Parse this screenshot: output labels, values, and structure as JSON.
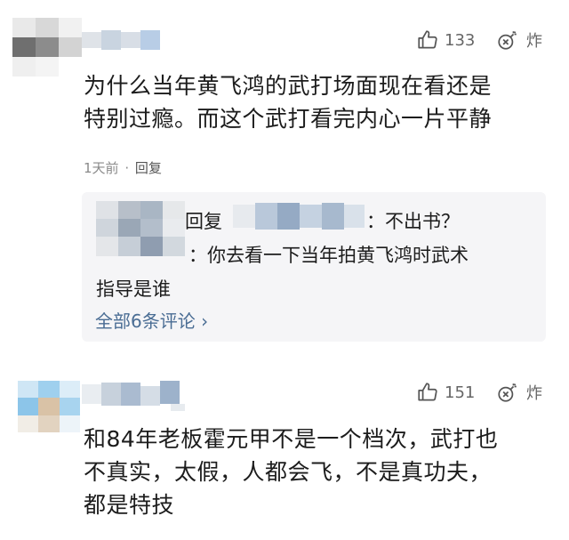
{
  "comments": [
    {
      "likes": "133",
      "bomb_label": "炸",
      "text_lines": [
        "为什么当年黄飞鸿的武打场面现在看还是",
        "特别过瘾。而这个武打看完内心一片平静"
      ],
      "time": "1天前",
      "separator": "·",
      "reply_label": "回复",
      "replies": {
        "reply1_prefix": "回复",
        "reply1_text": "：不出书？",
        "reply2_line1": "：你去看一下当年拍黄飞鸿时武术",
        "reply2_line2": "指导是谁",
        "all_replies": "全部6条评论 ›"
      }
    },
    {
      "likes": "151",
      "bomb_label": "炸",
      "text_lines": [
        "和84年老板霍元甲不是一个档次，武打也",
        "不真实，太假，人都会飞，不是真功夫，",
        "都是特技"
      ]
    }
  ],
  "colors": {
    "reply_box_bg": "#f5f5f7",
    "link": "#4a6d94",
    "meta": "#8a8a8a"
  },
  "icons": [
    "thumbs-up-icon",
    "bomb-icon"
  ]
}
